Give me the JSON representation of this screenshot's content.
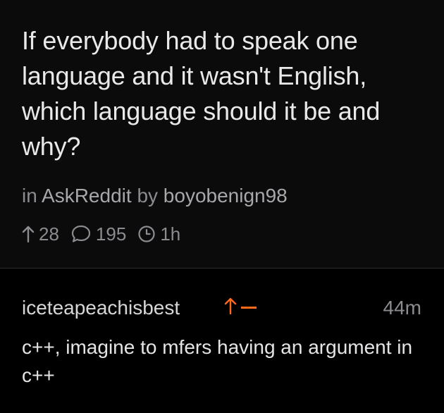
{
  "post": {
    "title": "If everybody had to speak one language and it wasn't English, which language should it be and why?",
    "in_prefix": "in",
    "subreddit": "AskReddit",
    "by_prefix": "by",
    "author": "boyobenign98",
    "upvotes": "28",
    "comments": "195",
    "age": "1h",
    "icons": {
      "upvote": "arrow-up-icon",
      "comments": "speech-bubble-icon",
      "age": "clock-icon"
    }
  },
  "comment": {
    "author": "iceteapeachisbest",
    "time": "44m",
    "body": "c++, imagine to mfers having an argument in c++",
    "icons": {
      "upvote": "arrow-up-icon",
      "downvote": "minus-icon"
    }
  },
  "colors": {
    "background": "#000000",
    "post_background": "#0b0b0b",
    "text_primary": "#e9e9ea",
    "text_secondary": "#8b8b90",
    "accent_orange": "#ff6a17",
    "divider": "#2c2c2e"
  }
}
